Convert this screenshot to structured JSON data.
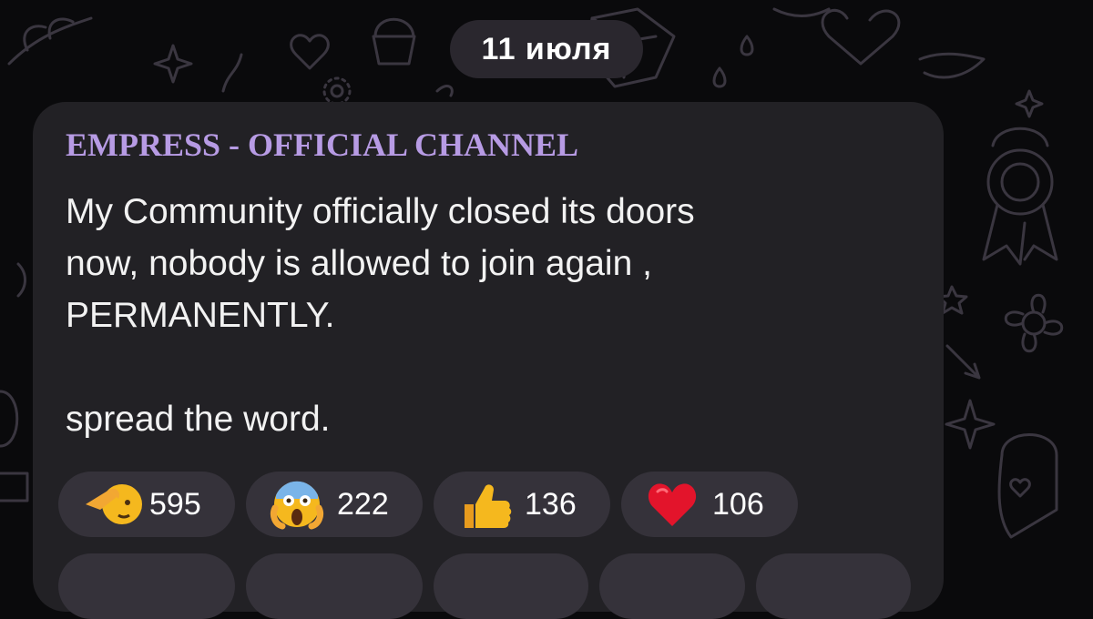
{
  "date_pill": "11 июля",
  "post": {
    "channel_name": "EMPRESS - OFFICIAL CHANNEL",
    "lines": [
      "My Community officially closed its doors",
      "now, nobody is allowed to join again ,",
      "PERMANENTLY."
    ],
    "closing_line": "spread the word."
  },
  "reactions": [
    {
      "icon": "saluting-face-icon",
      "count": "595"
    },
    {
      "icon": "screaming-face-icon",
      "count": "222"
    },
    {
      "icon": "thumbs-up-icon",
      "count": "136"
    },
    {
      "icon": "red-heart-icon",
      "count": "106"
    }
  ],
  "colors": {
    "background": "#0a0a0c",
    "bubble": "#222125",
    "reaction_pill": "#35323a",
    "channel_name": "#b79be4",
    "doodle": "#3a3640"
  }
}
